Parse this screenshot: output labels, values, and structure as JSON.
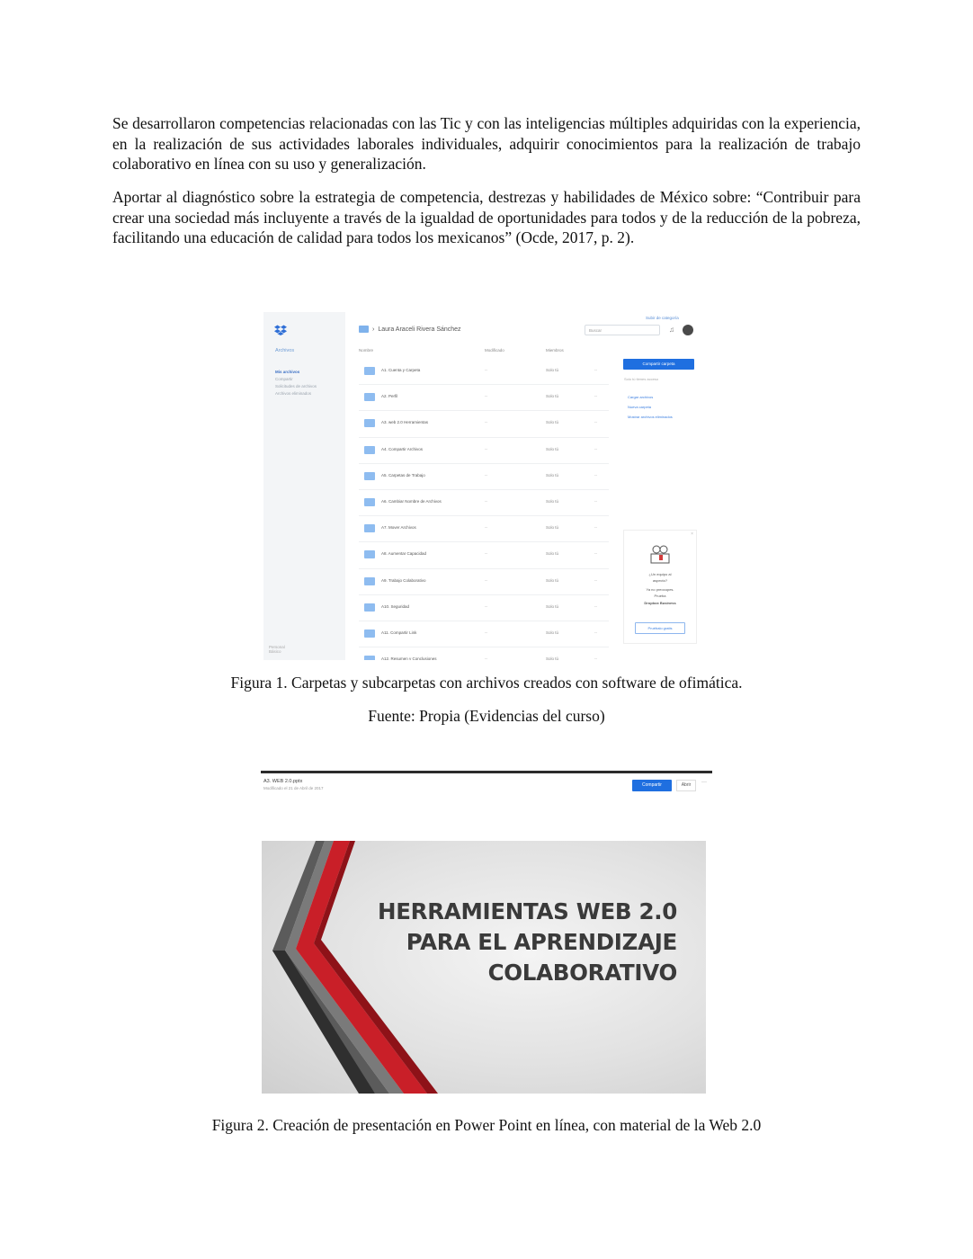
{
  "paragraphs": [
    "Se desarrollaron competencias relacionadas con las Tic y con las inteligencias múltiples adquiridas con la experiencia, en la realización de sus actividades laborales individuales, adquirir conocimientos para la realización de trabajo colaborativo en línea con su uso y generalización.",
    "Aportar al diagnóstico sobre la estrategia de competencia, destrezas y habilidades de México sobre: “Contribuir para crear una sociedad más incluyente a través de la igualdad de oportunidades para todos y de la reducción de la pobreza, facilitando una educación de calidad para todos los mexicanos” (Ocde, 2017, p. 2)."
  ],
  "figure1": {
    "caption": "Figura 1. Carpetas y subcarpetas con archivos creados con software de ofimática.",
    "source": "Fuente: Propia (Evidencias del curso)",
    "screenshot": {
      "sidebar": {
        "title": "Archivos",
        "items": [
          "Mis archivos",
          "Compartir",
          "Solicitudes de archivos",
          "Archivos eliminados"
        ],
        "footer_title": "Personal",
        "footer_sub": "Básico"
      },
      "breadcrumb": "Laura Araceli Rivera Sánchez",
      "upgrade_link": "Subir de categoría",
      "search_placeholder": "Buscar",
      "columns": {
        "name": "Nombre",
        "modified": "Modificado",
        "members": "Miembros"
      },
      "folders": [
        "A1. Cuenta y Carpeta",
        "A2. Perfil",
        "A3. web 2.0 Herramientas",
        "A4. Compartir Archivos",
        "A5. Carpetas de Trabajo",
        "A6. Cambiar Nombre de Archivos",
        "A7. Mover Archivos",
        "A8. Aumentar Capacidad",
        "A9. Trabajo Colaborativo",
        "A10. Seguridad",
        "A11. Compartir Link",
        "A12. Resumen y Conclusiones"
      ],
      "modified_value": "--",
      "members_value": "Solo tú",
      "share_button": "Compartir carpeta",
      "note": "Solo tú tienes acceso",
      "actions": [
        "Cargar archivos",
        "Nueva carpeta",
        "Mostrar archivos eliminados"
      ],
      "promo": {
        "line1": "¿Un equipo al",
        "line2": "aspecto?",
        "line3": "Ya no preocupes.",
        "line4": "Prueba",
        "line5": "Dropbox Business",
        "button": "Pruébalo gratis"
      }
    }
  },
  "figure2": {
    "caption": "Figura 2. Creación de presentación en Power Point en línea, con material de la Web 2.0",
    "screenshot": {
      "file_name": "A3. WEB 2.0.pptx",
      "modified": "Modificado el 21 de Abril de 2017",
      "share_button": "Compartir",
      "open_button": "Abrir",
      "more": "···",
      "slide_title_lines": [
        "HERRAMIENTAS WEB 2.0",
        "PARA EL APRENDIZAJE",
        "COLABORATIVO"
      ]
    }
  }
}
